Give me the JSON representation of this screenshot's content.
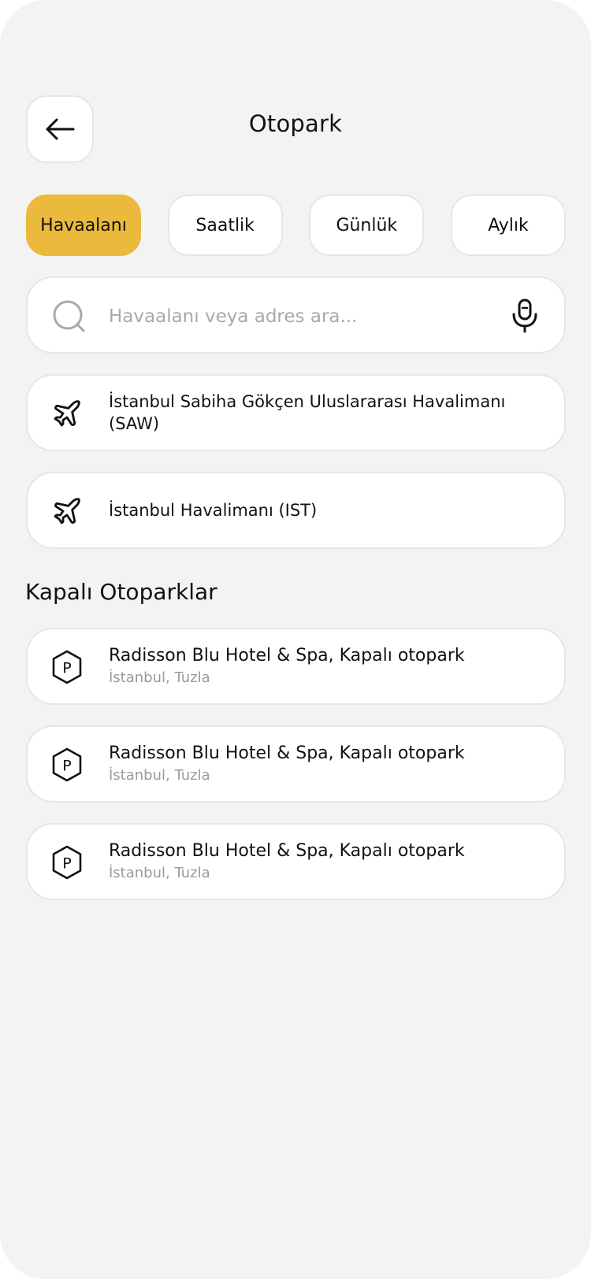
{
  "header": {
    "title": "Otopark"
  },
  "tabs": [
    {
      "label": "Havaalanı",
      "active": true
    },
    {
      "label": "Saatlik",
      "active": false
    },
    {
      "label": "Günlük",
      "active": false
    },
    {
      "label": "Aylık",
      "active": false
    }
  ],
  "search": {
    "placeholder": "Havaalanı veya adres ara..."
  },
  "airports": [
    {
      "name": "İstanbul Sabiha Gökçen Uluslararası Havalimanı (SAW)",
      "icon": "airplane-icon"
    },
    {
      "name": "İstanbul Havalimanı (IST)",
      "icon": "airplane-icon"
    }
  ],
  "section": {
    "title": "Kapalı Otoparklar"
  },
  "parkings": [
    {
      "name": "Radisson Blu Hotel & Spa, Kapalı otopark",
      "location": "İstanbul, Tuzla",
      "icon": "parking-icon"
    },
    {
      "name": "Radisson Blu Hotel & Spa, Kapalı otopark",
      "location": "İstanbul, Tuzla",
      "icon": "parking-icon"
    },
    {
      "name": "Radisson Blu Hotel & Spa, Kapalı otopark",
      "location": "İstanbul, Tuzla",
      "icon": "parking-icon"
    }
  ],
  "colors": {
    "accent": "#ebb93c",
    "background": "#f3f3f3",
    "card": "#ffffff",
    "muted": "#9a9a9a"
  }
}
